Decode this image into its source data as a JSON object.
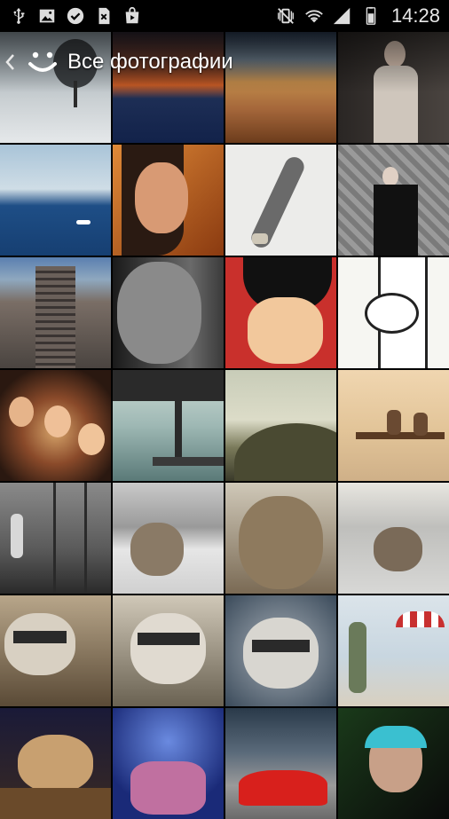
{
  "status_bar": {
    "time": "14:28",
    "left_icons": [
      "usb-icon",
      "image-icon",
      "check-circle-icon",
      "sim-error-icon",
      "shopping-bag-icon"
    ],
    "right_icons": [
      "vibrate-mute-icon",
      "wifi-icon",
      "signal-icon",
      "battery-icon"
    ]
  },
  "action_bar": {
    "title": "Все фотографии",
    "up_icon": "chevron-left-icon",
    "app_icon": "smiley-icon"
  },
  "photos": [
    {
      "name": "snowy-tree",
      "bg": "#7b8a93"
    },
    {
      "name": "sunset-sky",
      "bg": "#4a2c2a"
    },
    {
      "name": "tuscan-hills",
      "bg": "#9a6a3a"
    },
    {
      "name": "woman-portrait",
      "bg": "#3a3430"
    },
    {
      "name": "sea-boat",
      "bg": "#3f6e9e"
    },
    {
      "name": "girl-closeup",
      "bg": "#b65a24"
    },
    {
      "name": "skateboard",
      "bg": "#e6e6e1"
    },
    {
      "name": "violinist",
      "bg": "#6a6a6a"
    },
    {
      "name": "railway-tracks",
      "bg": "#5c6e80"
    },
    {
      "name": "man-portrait",
      "bg": "#444444"
    },
    {
      "name": "anime-luffy",
      "bg": "#c8322a"
    },
    {
      "name": "cartoon-tree",
      "bg": "#f2f2ee"
    },
    {
      "name": "party-crowd",
      "bg": "#2a1810"
    },
    {
      "name": "pier-water",
      "bg": "#8aa4a4"
    },
    {
      "name": "hill-landscape",
      "bg": "#a8a88a"
    },
    {
      "name": "bench-couple",
      "bg": "#d9c2a0"
    },
    {
      "name": "foggy-forest",
      "bg": "#6c6c6c"
    },
    {
      "name": "kitten-sink",
      "bg": "#8e8e8e"
    },
    {
      "name": "kitten-closeup",
      "bg": "#9a8a70"
    },
    {
      "name": "kitten-basin",
      "bg": "#b0b0ae"
    },
    {
      "name": "raccoon-guitar",
      "bg": "#6a5a44"
    },
    {
      "name": "raccoon-grin",
      "bg": "#8a8474"
    },
    {
      "name": "raccoon-snow",
      "bg": "#5a6a7a"
    },
    {
      "name": "deer-man-beach",
      "bg": "#c9d6e0"
    },
    {
      "name": "kitten-yawn",
      "bg": "#2a2a4a"
    },
    {
      "name": "concert-crowd",
      "bg": "#2448a8"
    },
    {
      "name": "red-ferrari",
      "bg": "#3a4a5a"
    },
    {
      "name": "dj-headphones",
      "bg": "#1a2a1a"
    }
  ]
}
